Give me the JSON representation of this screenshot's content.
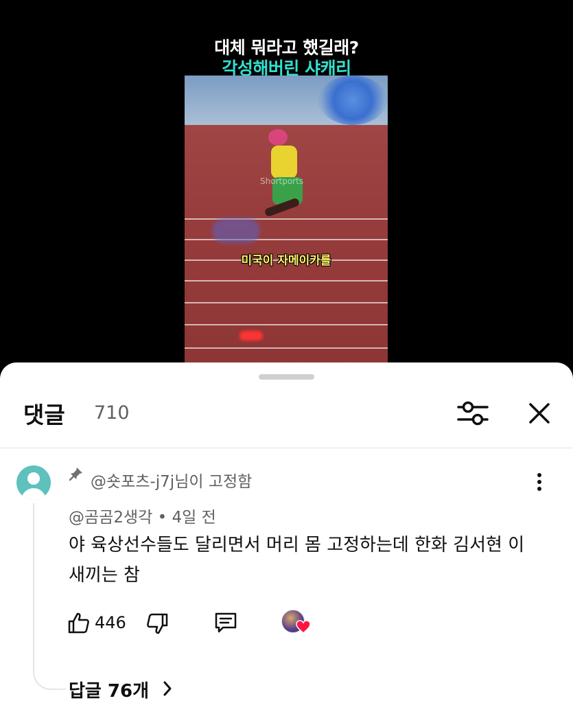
{
  "video": {
    "title_line1": "대체 뭐라고 했길래?",
    "title_line2": "각성해버린 샤캐리",
    "watermark": "Shortports",
    "caption": "미국이 자메이카를"
  },
  "comments_panel": {
    "title": "댓글",
    "count": "710",
    "filter_icon": "sliders-icon",
    "close_icon": "close-icon"
  },
  "comment": {
    "pinned_label": "@숏포츠-j7j님이 고정함",
    "author": "@곰곰2생각",
    "time": "• 4일 전",
    "text": "야 육상선수들도 달리면서 머리 몸 고정하는데 한화 김서현 이새끼는 참",
    "like_count": "446",
    "replies_label": "답글 76개",
    "creator_heart_color": "#ff1744"
  }
}
